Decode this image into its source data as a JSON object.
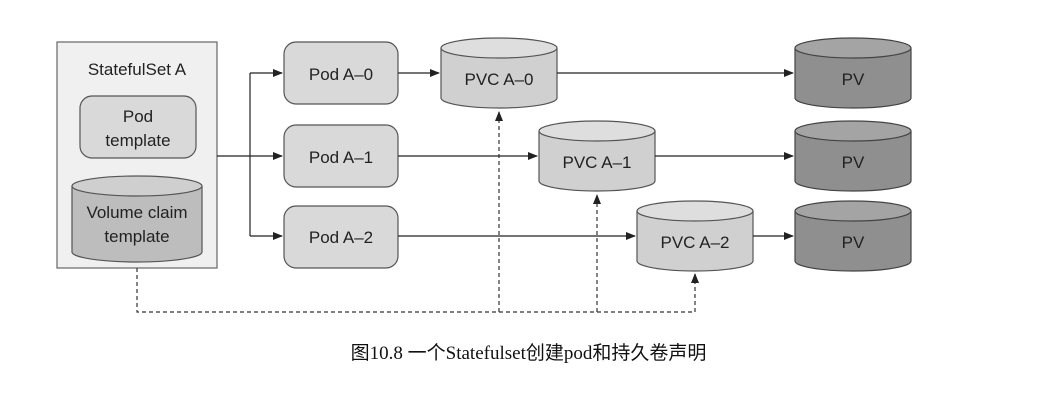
{
  "statefulset": {
    "title": "StatefulSet A",
    "pod_template_label": [
      "Pod",
      "template"
    ],
    "volume_claim_template_label": [
      "Volume claim",
      "template"
    ]
  },
  "pods": [
    {
      "label": "Pod A–0"
    },
    {
      "label": "Pod A–1"
    },
    {
      "label": "Pod A–2"
    }
  ],
  "pvcs": [
    {
      "label": "PVC A–0"
    },
    {
      "label": "PVC A–1"
    },
    {
      "label": "PVC A–2"
    }
  ],
  "pvs": [
    {
      "label": "PV"
    },
    {
      "label": "PV"
    },
    {
      "label": "PV"
    }
  ],
  "caption": "图10.8 一个Statefulset创建pod和持久卷声明",
  "colors": {
    "statefulset_bg": "#f0f0f0",
    "pod_fill": "#d9d9d9",
    "pvc_fill": "#d0d0d0",
    "pv_fill": "#8f8f8f",
    "claim_fill": "#bdbdbd"
  }
}
